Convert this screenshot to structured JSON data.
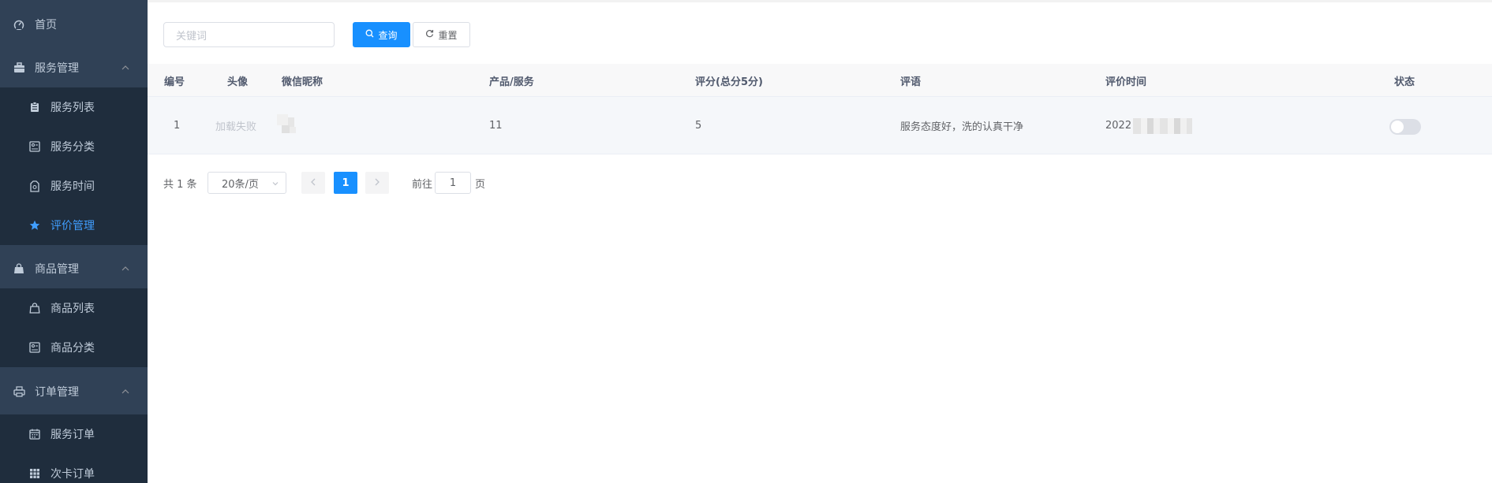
{
  "sidebar": {
    "home": "首页",
    "groups": [
      {
        "label": "服务管理",
        "items": [
          "服务列表",
          "服务分类",
          "服务时间",
          "评价管理"
        ]
      },
      {
        "label": "商品管理",
        "items": [
          "商品列表",
          "商品分类"
        ]
      },
      {
        "label": "订单管理",
        "items": [
          "服务订单",
          "次卡订单"
        ]
      }
    ],
    "active_item": "评价管理",
    "colors": {
      "bg": "#304156",
      "sub_bg": "#1f2d3d",
      "text": "#bfcbd9",
      "active": "#409eff"
    }
  },
  "search": {
    "placeholder": "关键词",
    "query_label": "查询",
    "reset_label": "重置"
  },
  "table": {
    "columns": [
      "编号",
      "头像",
      "微信昵称",
      "产品/服务",
      "评分(总分5分)",
      "评语",
      "评价时间",
      "状态"
    ],
    "rows": [
      {
        "id": "1",
        "avatar_text": "加载失败",
        "nickname": "",
        "product": "11",
        "score": "5",
        "comment": "服务态度好，洗的认真干净",
        "time": "2022",
        "status_on": false
      }
    ]
  },
  "pagination": {
    "total_text": "共 1 条",
    "page_size": "20条/页",
    "current_page": "1",
    "goto_prefix": "前往",
    "goto_value": "1",
    "goto_suffix": "页"
  },
  "accent_color": "#1890ff"
}
